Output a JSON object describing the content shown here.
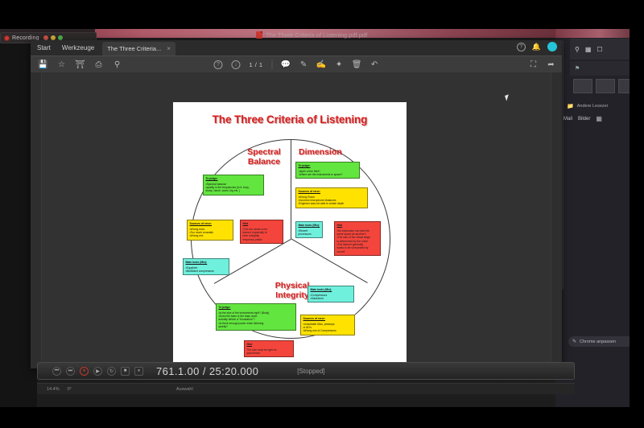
{
  "window": {
    "recording_label": "Recording",
    "pdf_window_title": "The Three Criteria of Listening pdf.pdf"
  },
  "pdf_reader": {
    "menu": [
      "Start",
      "Werkzeuge"
    ],
    "tab_label": "The Three Criteria...",
    "tab_close": "×",
    "page_counter": "1 / 1",
    "toolbar_left_icons": [
      "save-icon",
      "star-icon",
      "upload-icon",
      "print-icon",
      "search-icon"
    ],
    "toolbar_center_icons": [
      "help-icon",
      "download-icon"
    ],
    "toolbar_right_icons": [
      "comment-icon",
      "pen-icon",
      "highlight-icon",
      "shapes-icon",
      "trash-icon",
      "undo-icon"
    ],
    "top_right_icons": [
      "help-circle-icon",
      "bell-icon",
      "avatar"
    ]
  },
  "document": {
    "title": "The Three Criteria of Listening",
    "title_color": "#d81f1f",
    "sections": {
      "spectral": {
        "label_line1": "Spectral",
        "label_line2": "Balance",
        "to_judge": {
          "heading": "To judge:",
          "items": [
            "•Spectral balance",
            "•quality in the frequencies (is it: boxy,",
            "sharp, harsh, warm, big etc. )"
          ],
          "color": "#63e53f"
        },
        "sources_of_error": {
          "heading": "Sources of error:",
          "items": [
            "•Wrong mics",
            "•Too much crosstalk",
            "•Wrong mix"
          ],
          "color": "#ffe200"
        },
        "main_tools": {
          "heading": "Main tools (Mix):",
          "items": [
            "•Equalizer",
            "•Multiband compressors"
          ],
          "color": "#6ff0dd"
        },
        "hint": {
          "heading": "Hint",
          "items": [
            "•The ear needs to be",
            "trained, especially to",
            "hear unsightly",
            "frequency peaks"
          ],
          "color": "#f4453c"
        }
      },
      "dimension": {
        "label_line1": "Dimension",
        "to_judge": {
          "heading": "To judge:",
          "items": [
            "-depth of the field?",
            "-Where are the instruments in space?"
          ],
          "color": "#63e53f"
        },
        "sources_of_error": {
          "heading": "Sources of error:",
          "items": [
            "•Wrong Room",
            "•Incorrect microphone distances",
            "•Engineer was not able to create depth"
          ],
          "color": "#ffe200"
        },
        "main_tools": {
          "heading": "Main tools (Mix):",
          "items": [
            "•Reverb",
            "processors"
          ],
          "color": "#6ff0dd"
        },
        "hint": {
          "heading": "Hint",
          "items": [
            "•No instrument can take the",
            "same space as another!!",
            "•The size of the virtual stage",
            "is determined by the mixer",
            "•The listener generally",
            "wants to be surrounded by",
            "sound!"
          ],
          "color": "#f4453c"
        }
      },
      "physical": {
        "label_line1": "Physical",
        "label_line2": "Integrity",
        "to_judge": {
          "heading": "To judge:",
          "items": [
            "•Is the size of the instruments right? (Body)",
            "•Does the bass or the bass drum",
            "actually deliver a \"foundation\"?",
            "•Is there enough power when listening",
            "quietly?"
          ],
          "color": "#63e53f"
        },
        "sources_of_error": {
          "heading": "Sources of error:",
          "items": [
            "•Unsuitable Mics, preamps",
            "or AD's",
            "•Wrong use of Compressors"
          ],
          "color": "#ffe200"
        },
        "main_tools": {
          "heading": "Main tools (Mix):",
          "items": [
            "•Compressors",
            "•Saturators"
          ],
          "color": "#6ff0dd"
        },
        "hint": {
          "heading": "Hint",
          "items": [
            "The size must be right for",
            "quiet levels"
          ],
          "color": "#f4453c"
        }
      }
    }
  },
  "transport": {
    "timecode": "761.1.00 / 25:20.000",
    "status": "[Stopped]",
    "buttons": [
      "go-to-start",
      "go-to-end",
      "record",
      "play",
      "loop",
      "stop",
      "pause"
    ]
  },
  "status_bar": {
    "zoom": "14.4%",
    "grid": "0°",
    "mode": "Auswahl"
  },
  "right_app": {
    "chrome_pill_label": "Chrome anpassen",
    "folder_label": "Andere Lesezei",
    "tabs": [
      "Mail",
      "Bilder"
    ]
  }
}
